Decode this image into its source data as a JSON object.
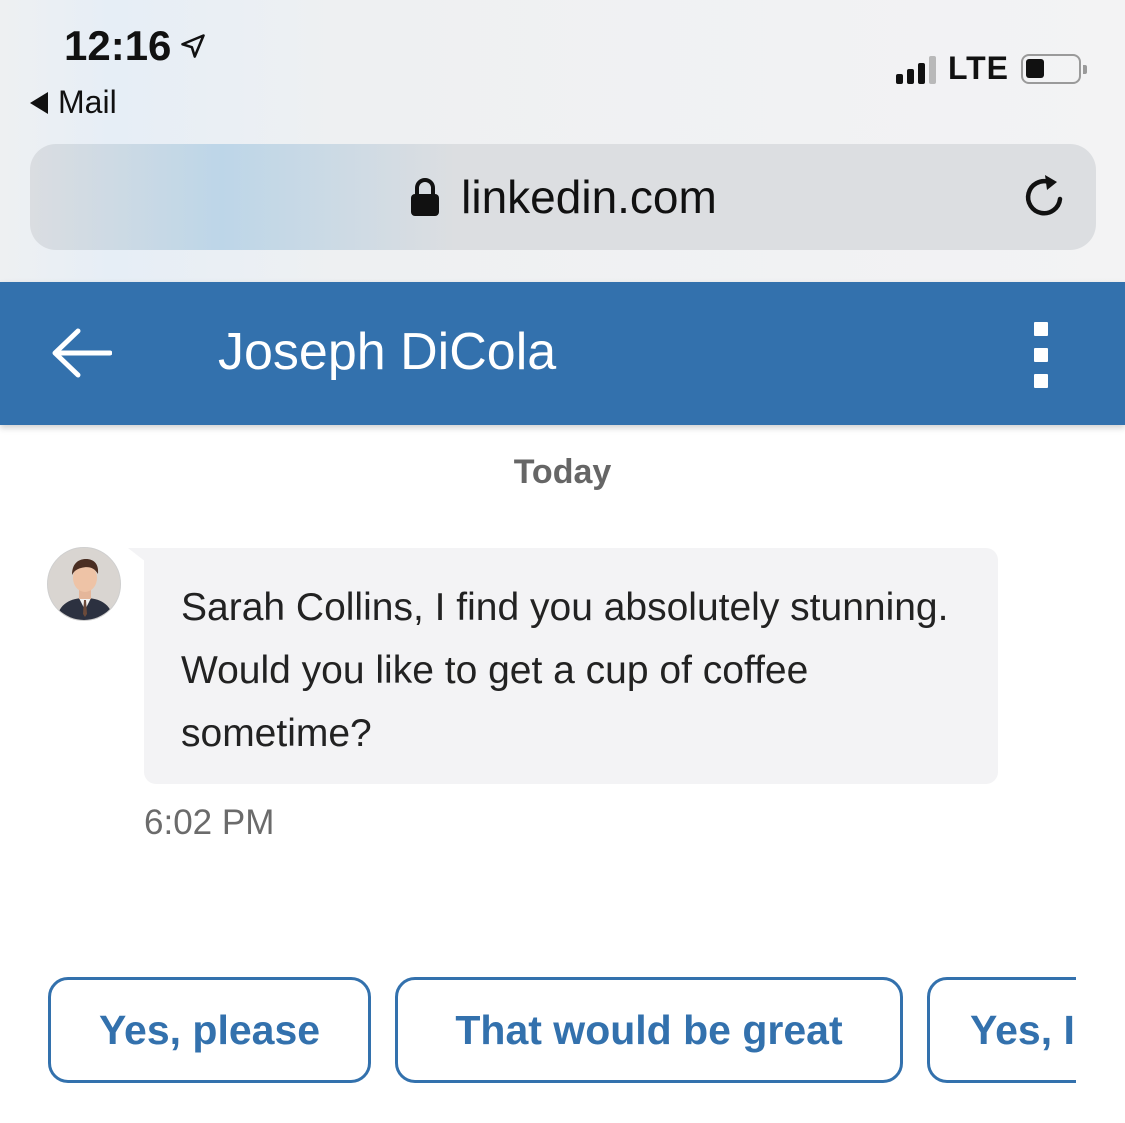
{
  "status_bar": {
    "time": "12:16",
    "back_app": "Mail",
    "network": "LTE",
    "icons": [
      "location-arrow-icon",
      "signal-bars-icon",
      "battery-icon"
    ]
  },
  "browser": {
    "url": "linkedin.com",
    "icons": [
      "lock-icon",
      "reload-icon"
    ]
  },
  "header": {
    "title": "Joseph DiCola",
    "background": "#3371ad",
    "icons": [
      "back-arrow-icon",
      "more-vertical-icon"
    ]
  },
  "conversation": {
    "day_label": "Today",
    "messages": [
      {
        "text": "Sarah Collins, I find you absolutely stunning. Would you like to get a cup of coffee sometime?",
        "time": "6:02 PM"
      }
    ]
  },
  "smart_replies": [
    "Yes, please",
    "That would be great",
    "Yes, I"
  ]
}
